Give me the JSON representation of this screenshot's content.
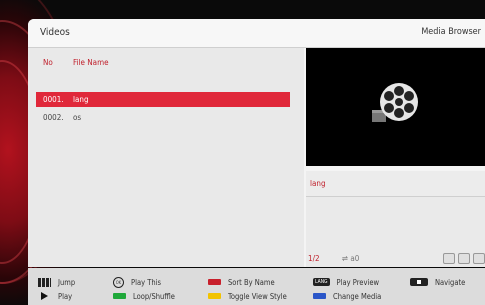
{
  "window": {
    "title": "Videos",
    "app_name": "Media Browser"
  },
  "list": {
    "columns": [
      "No",
      "File Name"
    ],
    "rows": [
      {
        "no": "0001.",
        "name": "lang",
        "selected": true
      },
      {
        "no": "0002.",
        "name": "os",
        "selected": false
      }
    ]
  },
  "preview": {
    "icon": "film-reel-icon"
  },
  "info": {
    "file_title": "lang",
    "page": "1/2",
    "usb_label": "a0"
  },
  "footer": {
    "jump": "Jump",
    "play": "Play",
    "play_this": "Play This",
    "loop_shuffle": "Loop/Shuffle",
    "sort_by_name": "Sort By Name",
    "toggle_view_style": "Toggle View Style",
    "play_preview": "Play Preview",
    "change_media": "Change Media",
    "navigate": "Navigate",
    "ok_label": "OK",
    "lang_label": "LANG"
  },
  "colors": {
    "accent": "#e0283a",
    "red_key": "#c8202c",
    "green_key": "#1fa83a",
    "yellow_key": "#f2c300",
    "blue_key": "#2a56c8"
  }
}
